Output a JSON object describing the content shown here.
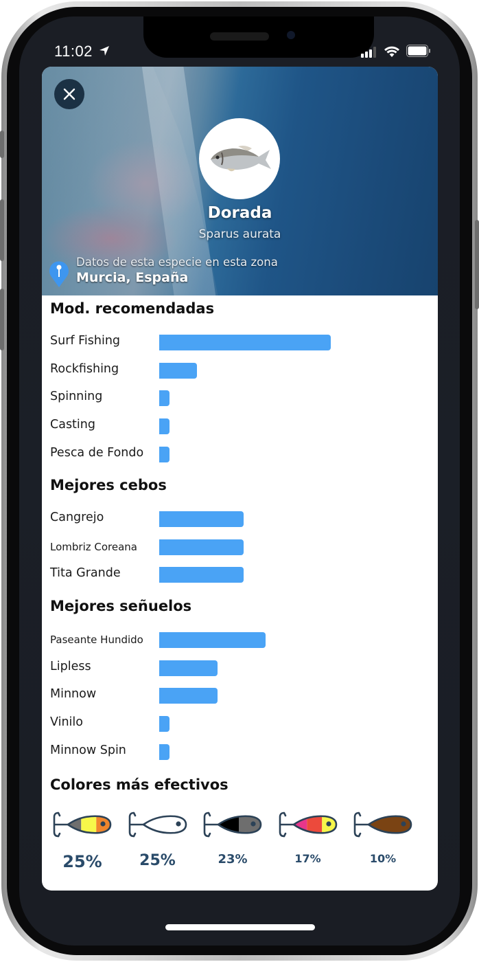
{
  "status_bar": {
    "time": "11:02",
    "icons": [
      "location-arrow-icon",
      "cellular-signal-icon",
      "wifi-icon",
      "battery-icon"
    ]
  },
  "header": {
    "close_icon": "close-icon",
    "species_name": "Dorada",
    "scientific_name": "Sparus aurata",
    "zone_label": "Datos de esta especie en esta zona",
    "zone_place": "Murcia, España",
    "pin_icon": "map-pin-icon"
  },
  "sections": {
    "modalities": {
      "title": "Mod. recomendadas",
      "items": [
        {
          "label": "Surf Fishing",
          "value": 100
        },
        {
          "label": "Rockfishing",
          "value": 22
        },
        {
          "label": "Spinning",
          "value": 6
        },
        {
          "label": "Casting",
          "value": 6
        },
        {
          "label": "Pesca de Fondo",
          "value": 6
        }
      ]
    },
    "baits": {
      "title": "Mejores cebos",
      "items": [
        {
          "label": "Cangrejo",
          "value": 49
        },
        {
          "label": "Lombriz Coreana",
          "value": 49
        },
        {
          "label": "Tita Grande",
          "value": 49
        }
      ]
    },
    "lures": {
      "title": "Mejores señuelos",
      "items": [
        {
          "label": "Paseante Hundido",
          "value": 62
        },
        {
          "label": "Lipless",
          "value": 34
        },
        {
          "label": "Minnow",
          "value": 34
        },
        {
          "label": "Vinilo",
          "value": 6
        },
        {
          "label": "Minnow Spin",
          "value": 6
        }
      ]
    },
    "colors": {
      "title": "Colores más efectivos",
      "items": [
        {
          "percent": "25%",
          "icon": "lure-gray-yellow-orange-icon",
          "segments": [
            "#6e6e6e",
            "#f7f74a",
            "#f0852c"
          ]
        },
        {
          "percent": "25%",
          "icon": "lure-white-icon",
          "segments": [
            "#ffffff"
          ]
        },
        {
          "percent": "23%",
          "icon": "lure-black-gray-icon",
          "segments": [
            "#000000",
            "#6e6e6e"
          ]
        },
        {
          "percent": "17%",
          "icon": "lure-pink-red-yellow-icon",
          "segments": [
            "#e8368a",
            "#ec4a3c",
            "#f7f74a"
          ]
        },
        {
          "percent": "10%",
          "icon": "lure-brown-icon",
          "segments": [
            "#7a4313"
          ]
        }
      ]
    }
  },
  "colors": {
    "bar": "#4aa3f5",
    "percent_text": "#2a4b6a",
    "lure_outline": "#2c4257"
  }
}
